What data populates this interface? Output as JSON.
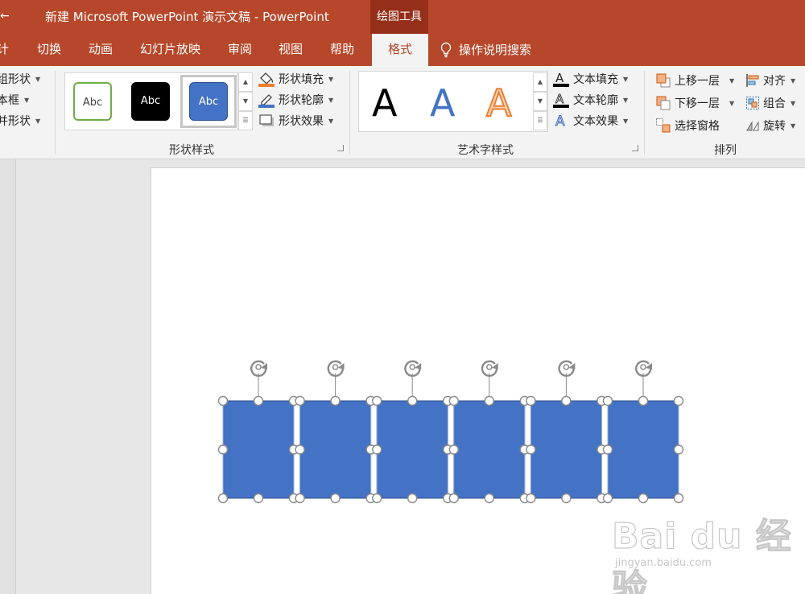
{
  "titlebar": {
    "back_glyph": "←",
    "title": "新建 Microsoft PowerPoint 演示文稿  -  PowerPoint",
    "contextual_tab": "绘图工具"
  },
  "tabs": [
    {
      "label": "计",
      "active": false
    },
    {
      "label": "切换",
      "active": false
    },
    {
      "label": "动画",
      "active": false
    },
    {
      "label": "幻灯片放映",
      "active": false
    },
    {
      "label": "审阅",
      "active": false
    },
    {
      "label": "视图",
      "active": false
    },
    {
      "label": "帮助",
      "active": false
    },
    {
      "label": "格式",
      "active": true
    }
  ],
  "search": {
    "label": "操作说明搜索",
    "icon": "lightbulb-icon"
  },
  "ribbon": {
    "insert_shapes": {
      "items": [
        "组形状",
        "本框",
        "并形状"
      ]
    },
    "shape_styles": {
      "label": "形状样式",
      "samples": [
        {
          "text": "Abc",
          "style": "outline-green"
        },
        {
          "text": "Abc",
          "style": "solid-black"
        },
        {
          "text": "Abc",
          "style": "solid-blue",
          "selected": true
        }
      ],
      "fill": "形状填充",
      "outline": "形状轮廓",
      "effects": "形状效果"
    },
    "wordart_styles": {
      "label": "艺术字样式",
      "samples": [
        "A",
        "A",
        "A"
      ],
      "fill": "文本填充",
      "outline": "文本轮廓",
      "effects": "文本效果"
    },
    "arrange": {
      "label": "排列",
      "bring_forward": "上移一层",
      "send_backward": "下移一层",
      "selection_pane": "选择窗格",
      "align": "对齐",
      "group": "组合",
      "rotate": "旋转"
    }
  },
  "colors": {
    "accent": "#b7472a",
    "accent_dark": "#962f19",
    "shape_fill": "#4472c4",
    "shape_border": "#2f528f"
  },
  "slide": {
    "shape_count": 6
  },
  "watermark": {
    "brand": "Bai du 经验",
    "url": "jingyan.baidu.com"
  }
}
